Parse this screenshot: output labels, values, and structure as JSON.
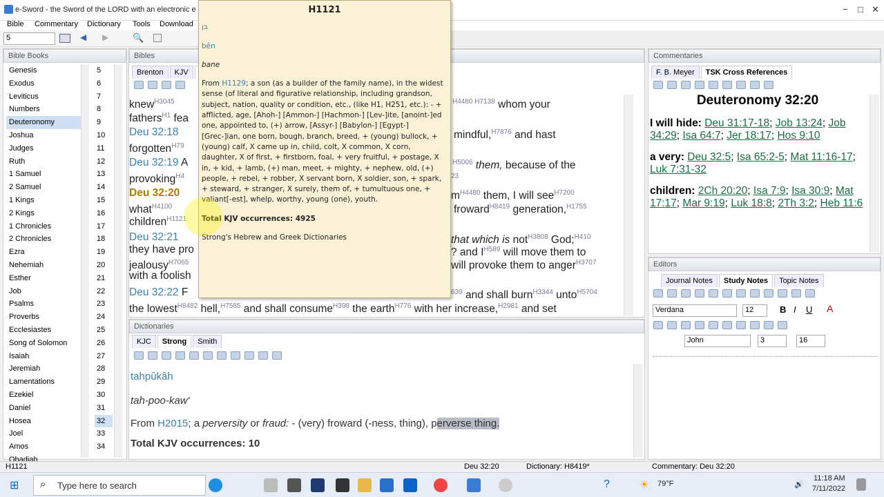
{
  "window": {
    "title": "e-Sword - the Sword of the LORD with an electronic e",
    "controls": [
      "−",
      "□",
      "✕"
    ]
  },
  "menu": [
    "Bible",
    "Commentary",
    "Dictionary",
    "Tools",
    "Download"
  ],
  "toolbar": {
    "chapter_value": "5"
  },
  "panes": {
    "bible_books": "Bible Books",
    "bibles": "Bibles",
    "dictionaries": "Dictionaries",
    "commentaries": "Commentaries",
    "editors": "Editors"
  },
  "books": [
    "Genesis",
    "Exodus",
    "Leviticus",
    "Numbers",
    "Deuteronomy",
    "Joshua",
    "Judges",
    "Ruth",
    "1 Samuel",
    "2 Samuel",
    "1 Kings",
    "2 Kings",
    "1 Chronicles",
    "2 Chronicles",
    "Ezra",
    "Nehemiah",
    "Esther",
    "Job",
    "Psalms",
    "Proverbs",
    "Ecclesiastes",
    "Song of Solomon",
    "Isaiah",
    "Jeremiah",
    "Lamentations",
    "Ezekiel",
    "Daniel",
    "Hosea",
    "Joel",
    "Amos",
    "Obadiah"
  ],
  "chapters": [
    "5",
    "6",
    "7",
    "8",
    "9",
    "10",
    "11",
    "12",
    "13",
    "14",
    "15",
    "16",
    "17",
    "18",
    "19",
    "20",
    "21",
    "22",
    "23",
    "24",
    "25",
    "26",
    "27",
    "28",
    "29",
    "30",
    "31",
    "32",
    "33",
    "34"
  ],
  "bible_tabs": [
    "Brenton",
    "KJV",
    "K"
  ],
  "verses": {
    "l1a": "knew",
    "l1b": "H3045",
    "l1c": " whom your",
    "l2a": "fathers",
    "l2b": "H1",
    "l2c": " fea",
    "v18ref": "Deu 32:18",
    "v18a": "mindful,",
    "v18b": "H7876",
    "v18c": " and hast",
    "l4a": "forgotten",
    "l4b": "H79",
    "v19ref": "Deu 32:19",
    "v19a": " A",
    "v19b": "H5006",
    "v19c": " them,",
    "v19d": " because of the",
    "l6a": "provoking",
    "l6b": "H4",
    "l6c": "23",
    "v20ref": "Deu 32:20",
    "v20a": "m",
    "v20b": "H4480",
    "v20c": " them, I will see",
    "v20d": "H7200",
    "l8a": "what",
    "l8b": "H4100",
    "l8c": " froward",
    "l8d": "H8419",
    "l8e": " generation,",
    "l8f": "H1755",
    "l9a": "children",
    "l9b": "H1121",
    "v21ref": "Deu 32:21",
    "v21a": "that which is",
    "v21b": " not",
    "v21c": "H3808",
    "v21d": " God;",
    "v21e": "H410",
    "l11a": "they have pro",
    "l11b": "? and I",
    "l11c": "H589",
    "l11d": " will move them to",
    "l12a": "jealousy",
    "l12b": "H7065",
    "l12c": "will provoke them to anger",
    "l12d": "H3707",
    "l13a": "with a foolish",
    "v22ref": "Deu 32:22",
    "v22a": " F",
    "v22b": "639",
    "v22c": " and shall burn",
    "v22d": "H3344",
    "v22e": " unto",
    "v22f": "H5704",
    "l15a": "the lowest",
    "l15b": "H8482",
    "l15c": " hell,",
    "l15d": "H7585",
    "l15e": " and shall consume",
    "l15f": "H398",
    "l15g": " the earth",
    "l15h": "H776",
    "l15i": " with her increase,",
    "l15j": "H2981",
    "l15k": " and set"
  },
  "popup": {
    "heading": "H1121",
    "hebrew": "בּן",
    "translit": "bên",
    "pron": "bane",
    "def_from": "From",
    "def_ref": "H1129",
    "def_text": "; a son (as a builder of the family name), in the widest sense (of literal and figurative relationship, including grandson, subject, nation, quality or condition, etc., (like H1, H251, etc.): - + afflicted, age, [Ahoh-] [Ammon-] [Hachmon-] [Lev-]ite, [anoint-]ed one, appointed to, (+) arrow, [Assyr-] [Babylon-] [Egypt-] [Grec-]ian, one born, bough, branch, breed, + (young) bullock, + (young) calf, X came up in, child, colt, X common, X corn, daughter, X of first, + firstborn, foal, + very fruitful, + postage, X in, + kid, + lamb, (+) man, meet, + mighty, + nephew, old, (+) people, + rebel, + robber, X servant born, X soldier, son, + spark, + steward, + stranger, X surely, them of, + tumultuous one, + valiant[-est], whelp, worthy, young (one), youth.",
    "total": "Total KJV occurrences: 4925",
    "source": "Strong's Hebrew and Greek Dictionaries"
  },
  "dict_tabs": [
    "KJC",
    "Strong",
    "Smith"
  ],
  "dict": {
    "translit": "tahpûkâh",
    "pron": "tah-poo-kaw'",
    "from": "From",
    "ref": "H2015",
    "semi": ";",
    "a": " a ",
    "w1": "perversity",
    "or": " or ",
    "w2": "fraud:",
    "rest": " -  (very) froward (-ness, thing), p",
    "hl": "erverse thing.",
    "total": "Total KJV occurrences: 10"
  },
  "comm_tabs": [
    "F. B. Meyer",
    "TSK Cross References"
  ],
  "comm": {
    "heading": "Deuteronomy 32:20",
    "e1": "I will hide:",
    "e1r": [
      "Deu 31:17-18",
      "Job 13:24",
      "Job 34:29",
      "Isa 64:7",
      "Jer 18:17",
      "Hos 9:10"
    ],
    "e2": "a very:",
    "e2r": [
      "Deu 32:5",
      "Isa 65:2-5",
      "Mat 11:16-17",
      "Luk 7:31-32"
    ],
    "e3": "children:",
    "e3r": [
      "2Ch 20:20",
      "Isa 7:9",
      "Isa 30:9",
      "Mat 17:17",
      "Mar 9:19",
      "Luk 18:8",
      "2Th 3:2",
      "Heb 11:6"
    ]
  },
  "editor_tabs": [
    "Journal Notes",
    "Study Notes",
    "Topic Notes"
  ],
  "editor": {
    "font": "Verdana",
    "size": "12",
    "font2": "John",
    "n1": "3",
    "n2": "16"
  },
  "status": {
    "left": "H1121",
    "ref": "Deu 32:20",
    "dictionary": "Dictionary: H8419*",
    "commentary": "Commentary: Deu 32:20"
  },
  "taskbar": {
    "search_placeholder": "Type here to search",
    "weather": "79°F",
    "time": "11:18 AM",
    "date": "7/11/2022"
  }
}
